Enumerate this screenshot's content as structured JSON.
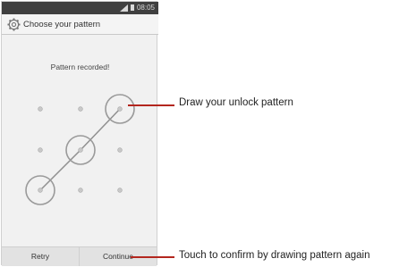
{
  "status_bar": {
    "time": "08:05",
    "signal_icon": "signal-icon",
    "battery_icon": "battery-icon"
  },
  "title_bar": {
    "icon": "gear-icon",
    "title": "Choose your pattern"
  },
  "pattern": {
    "message": "Pattern recorded!",
    "path_dots": [
      2,
      4,
      6
    ]
  },
  "buttons": {
    "retry": "Retry",
    "continue": "Continue"
  },
  "callouts": {
    "draw": "Draw your unlock pattern",
    "confirm": "Touch to confirm by drawing pattern again"
  },
  "colors": {
    "accent_red": "#b3261e",
    "ring": "#9a9a9a",
    "path": "#8f8f8f"
  }
}
